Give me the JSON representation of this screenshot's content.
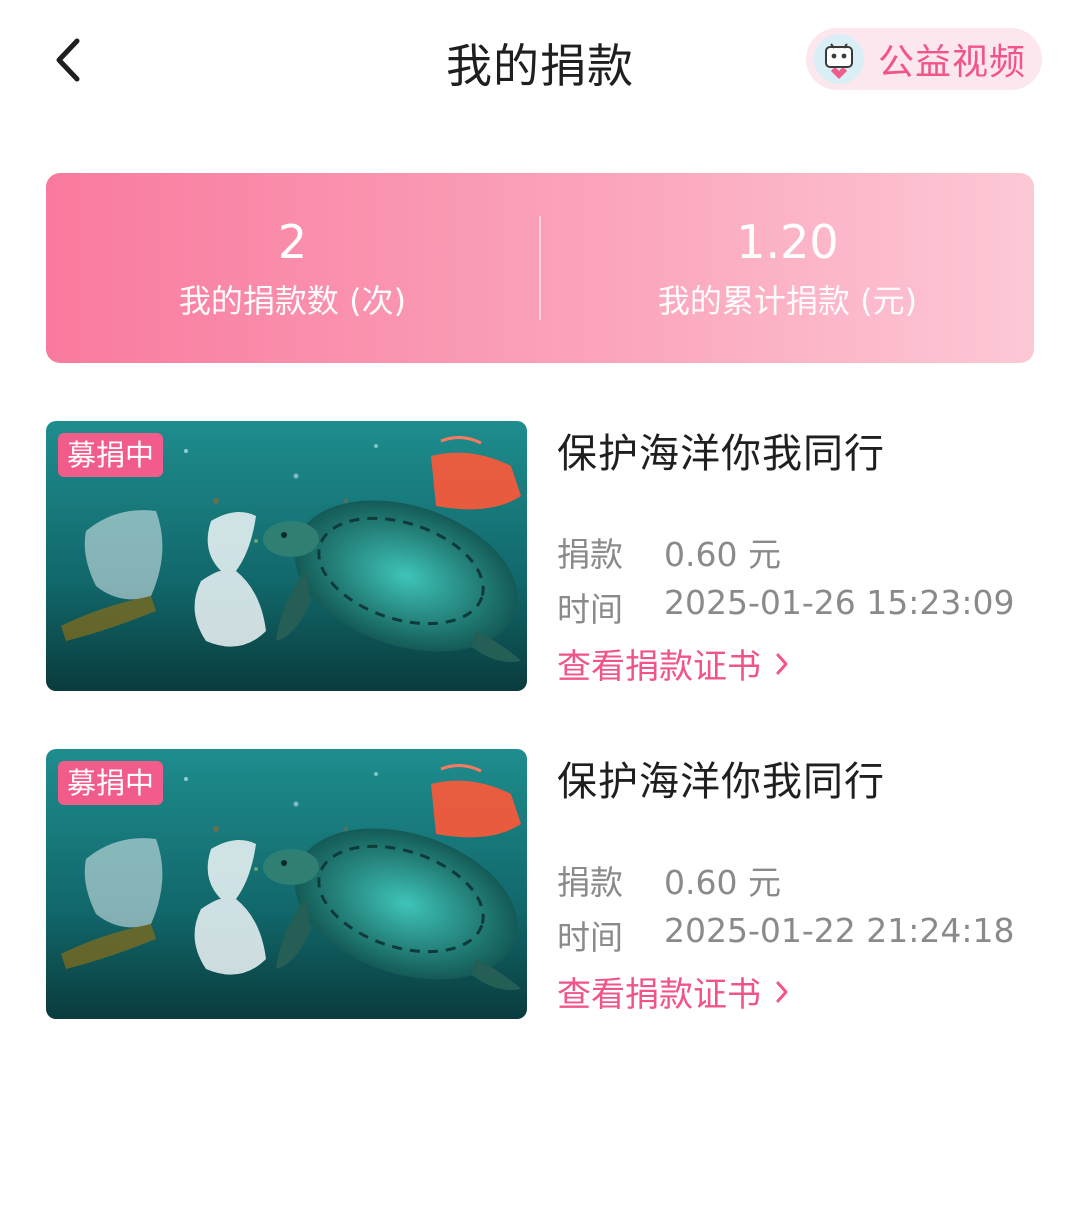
{
  "header": {
    "title": "我的捐款",
    "video_label": "公益视频"
  },
  "stats": {
    "count_value": "2",
    "count_label": "我的捐款数 (次)",
    "total_value": "1.20",
    "total_label": "我的累计捐款 (元)"
  },
  "records": [
    {
      "badge": "募捐中",
      "title": "保护海洋你我同行",
      "amount_key": "捐款",
      "amount_value": "0.60 元",
      "time_key": "时间",
      "time_value": "2025-01-26 15:23:09",
      "cert_link": "查看捐款证书"
    },
    {
      "badge": "募捐中",
      "title": "保护海洋你我同行",
      "amount_key": "捐款",
      "amount_value": "0.60 元",
      "time_key": "时间",
      "time_value": "2025-01-22 21:24:18",
      "cert_link": "查看捐款证书"
    }
  ],
  "colors": {
    "accent": "#f0548a",
    "badge": "#f25c8a",
    "banner_start": "#f97a9e",
    "banner_end": "#fdc8d6"
  },
  "icons": {
    "back": "chevron-left-icon",
    "mascot": "mascot-icon",
    "chevron": "chevron-right-icon"
  }
}
